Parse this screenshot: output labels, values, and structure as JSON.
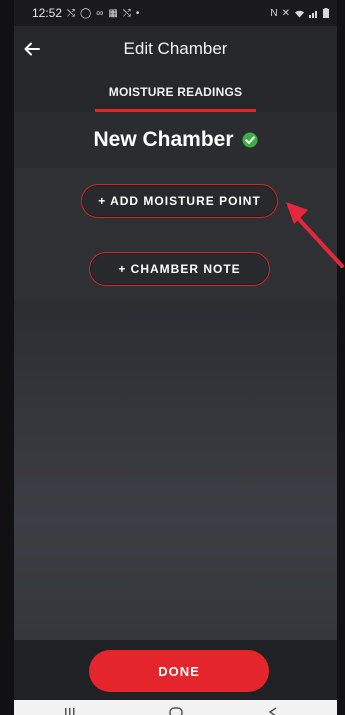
{
  "status_bar": {
    "time": "12:52",
    "left_icons": [
      "missed-call-icon",
      "circle-icon",
      "voicemail-icon",
      "message-icon",
      "missed-call-icon",
      "dot-icon"
    ],
    "right_icons": [
      "nfc-icon",
      "mute-icon",
      "wifi-icon",
      "signal-icon",
      "battery-icon"
    ]
  },
  "app_bar": {
    "title": "Edit Chamber",
    "back_icon": "arrow-left-icon"
  },
  "tabs": [
    {
      "label": "MOISTURE READINGS",
      "selected": true
    }
  ],
  "chamber": {
    "title": "New Chamber",
    "status_icon": "check-circle-icon",
    "status_color": "#3cb043"
  },
  "actions": {
    "add_moisture_point": "+ ADD MOISTURE POINT",
    "chamber_note": "+ CHAMBER NOTE"
  },
  "bottom": {
    "done_label": "DONE"
  },
  "colors": {
    "accent": "#e4252b",
    "annotation_arrow": "#e8263a"
  }
}
